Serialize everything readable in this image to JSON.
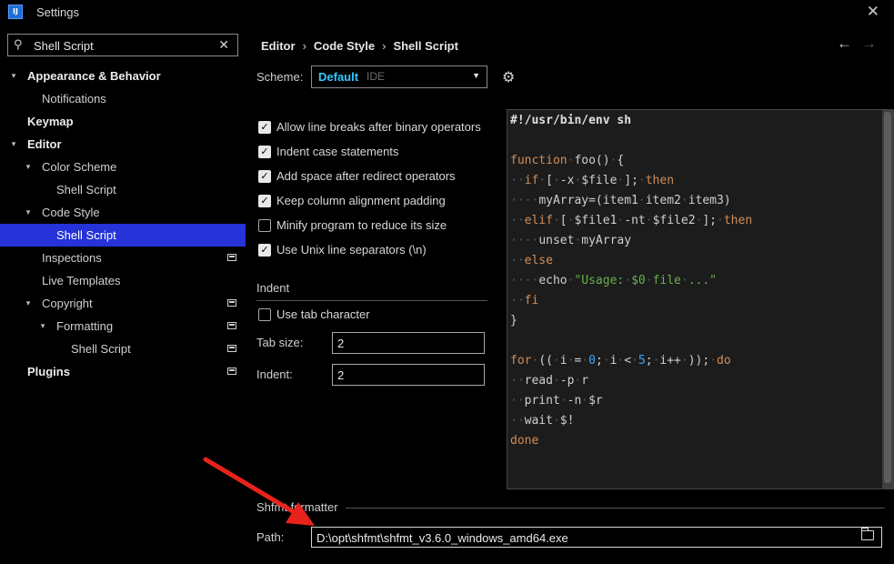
{
  "window": {
    "title": "Settings",
    "app_icon_text": "IJ"
  },
  "search": {
    "value": "Shell Script"
  },
  "tree": [
    {
      "label": "Appearance & Behavior",
      "level": 0,
      "arrow": "down",
      "bold": true,
      "selected": false,
      "badge": false
    },
    {
      "label": "Notifications",
      "level": 1,
      "arrow": "",
      "bold": false,
      "selected": false,
      "badge": false
    },
    {
      "label": "Keymap",
      "level": 0,
      "arrow": "",
      "bold": true,
      "selected": false,
      "badge": false
    },
    {
      "label": "Editor",
      "level": 0,
      "arrow": "down",
      "bold": true,
      "selected": false,
      "badge": false
    },
    {
      "label": "Color Scheme",
      "level": 1,
      "arrow": "down",
      "bold": false,
      "selected": false,
      "badge": false
    },
    {
      "label": "Shell Script",
      "level": 2,
      "arrow": "",
      "bold": false,
      "selected": false,
      "badge": false
    },
    {
      "label": "Code Style",
      "level": 1,
      "arrow": "down",
      "bold": false,
      "selected": false,
      "badge": false
    },
    {
      "label": "Shell Script",
      "level": 2,
      "arrow": "",
      "bold": false,
      "selected": true,
      "badge": false
    },
    {
      "label": "Inspections",
      "level": 1,
      "arrow": "",
      "bold": false,
      "selected": false,
      "badge": true
    },
    {
      "label": "Live Templates",
      "level": 1,
      "arrow": "",
      "bold": false,
      "selected": false,
      "badge": false
    },
    {
      "label": "Copyright",
      "level": 1,
      "arrow": "down",
      "bold": false,
      "selected": false,
      "badge": true
    },
    {
      "label": "Formatting",
      "level": 2,
      "arrow": "down",
      "bold": false,
      "selected": false,
      "badge": true
    },
    {
      "label": "Shell Script",
      "level": 3,
      "arrow": "",
      "bold": false,
      "selected": false,
      "badge": true
    },
    {
      "label": "Plugins",
      "level": 0,
      "arrow": "",
      "bold": true,
      "selected": false,
      "badge": true
    }
  ],
  "breadcrumb": [
    "Editor",
    "Code Style",
    "Shell Script"
  ],
  "scheme": {
    "label": "Scheme:",
    "value": "Default",
    "scope": "IDE"
  },
  "options": [
    {
      "label": "Allow line breaks after binary operators",
      "checked": true
    },
    {
      "label": "Indent case statements",
      "checked": true
    },
    {
      "label": "Add space after redirect operators",
      "checked": true
    },
    {
      "label": "Keep column alignment padding",
      "checked": true
    },
    {
      "label": "Minify program to reduce its size",
      "checked": false
    },
    {
      "label": "Use Unix line separators (\\n)",
      "checked": true
    }
  ],
  "indent": {
    "section_label": "Indent",
    "use_tab_label": "Use tab character",
    "use_tab_checked": false,
    "tab_size_label": "Tab size:",
    "tab_size_value": "2",
    "indent_label": "Indent:",
    "indent_value": "2"
  },
  "code_lines": [
    "#!/usr/bin/env sh",
    "",
    "function foo() {",
    "  if [ -x $file ]; then",
    "    myArray=(item1 item2 item3)",
    "  elif [ $file1 -nt $file2 ]; then",
    "    unset myArray",
    "  else",
    "    echo \"Usage: $0 file ...\"",
    "  fi",
    "}",
    "",
    "for (( i = 0; i < 5; i++ )); do",
    "  read -p r",
    "  print -n $r",
    "  wait $!",
    "done"
  ],
  "formatter": {
    "section_label": "Shfmt formatter",
    "path_label": "Path:",
    "path_value": "D:\\opt\\shfmt\\shfmt_v3.6.0_windows_amd64.exe"
  },
  "colors": {
    "selection": "#2533d8",
    "scheme_value": "#35c7ff",
    "keyword": "#cf8e5a",
    "string": "#6ab04c",
    "number": "#3aa4ff",
    "annotation_arrow": "#e8231c"
  }
}
